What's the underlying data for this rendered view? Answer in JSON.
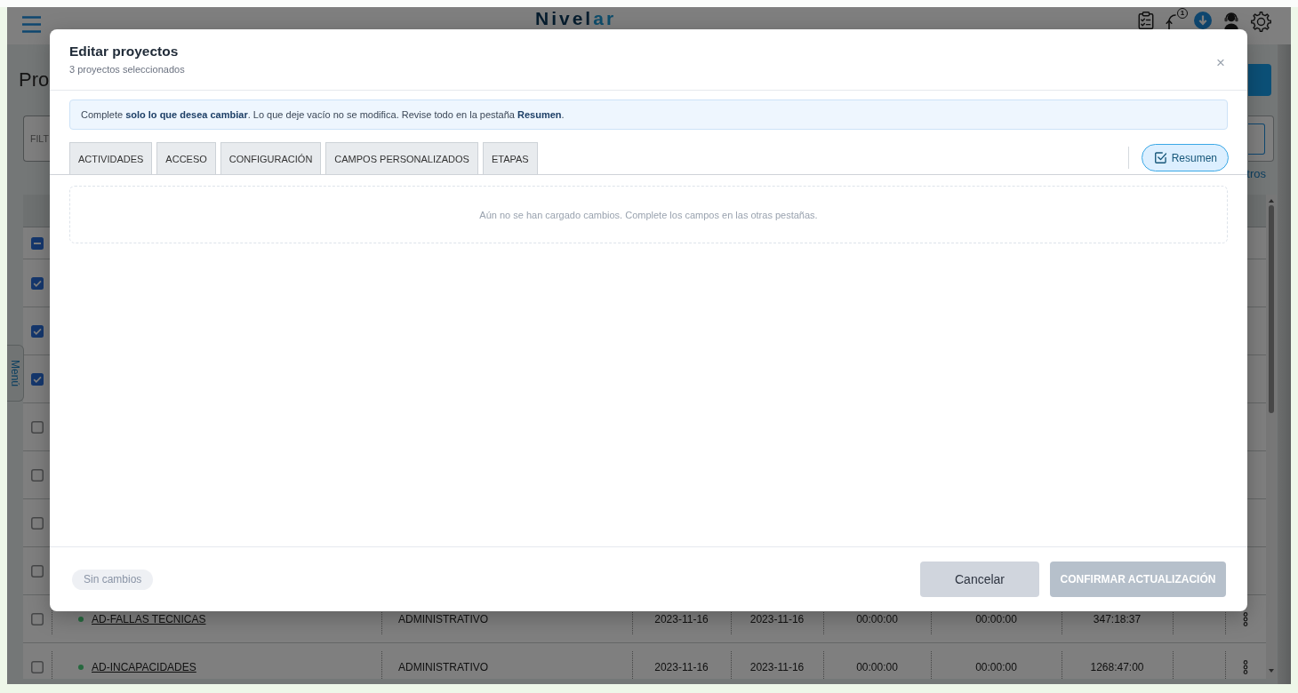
{
  "top_bar": {
    "logo": {
      "text": "Nivel",
      "accent": "ar"
    },
    "notification_badge": "1"
  },
  "page": {
    "title": "Pro",
    "filter": {
      "placeholder": "FILT"
    },
    "link": "tros"
  },
  "side_tab": {
    "label": "Menú"
  },
  "table": {
    "select_all": {
      "indeterminate": true
    },
    "rows": [
      {
        "checked": true
      },
      {
        "checked": true
      },
      {
        "checked": true
      },
      {
        "checked": false
      },
      {
        "checked": false
      },
      {
        "checked": false
      },
      {
        "checked": false
      },
      {
        "checked": false,
        "cells": [
          "AD-FALLAS TECNICAS",
          "ADMINISTRATIVO",
          "2023-11-16",
          "2023-11-16",
          "00:00:00",
          "00:00:00",
          "347:18:37"
        ]
      },
      {
        "checked": false,
        "cells": [
          "AD-INCAPACIDADES",
          "ADMINISTRATIVO",
          "2023-11-16",
          "2023-11-16",
          "00:00:00",
          "00:00:00",
          "1268:47:00"
        ]
      }
    ]
  },
  "dialog": {
    "title": "Editar proyectos",
    "subtitle": "3 proyectos seleccionados",
    "close": "×",
    "notice": "Complete **solo lo que desea cambiar**. Lo que deje vacío no se modifica. Revise todo en la pestaña **Resumen**.",
    "tabs": [
      {
        "label": "ACTIVIDADES",
        "selected": false
      },
      {
        "label": "ACCESO",
        "selected": false
      },
      {
        "label": "CONFIGURACIÓN",
        "selected": false
      },
      {
        "label": "CAMPOS PERSONALIZADOS",
        "selected": false
      },
      {
        "label": "ETAPAS",
        "selected": false
      }
    ],
    "summary_tab": {
      "label": "Resumen",
      "selected": true
    },
    "empty_message": "Aún no se han cargado cambios. Complete los campos en las otras pestañas.",
    "footer": {
      "status": "Sin cambios",
      "buttons": [
        {
          "label": "Cancelar",
          "kind": "secondary",
          "disabled": false
        },
        {
          "label": "CONFIRMAR ACTUALIZACIÓN",
          "kind": "primary",
          "disabled": true
        }
      ]
    }
  }
}
